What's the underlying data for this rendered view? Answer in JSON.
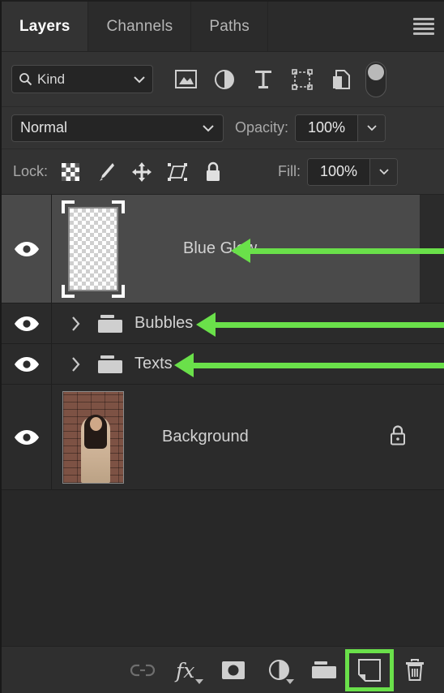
{
  "panel": {
    "tabs": [
      {
        "label": "Layers",
        "active": true
      },
      {
        "label": "Channels",
        "active": false
      },
      {
        "label": "Paths",
        "active": false
      }
    ],
    "menu_icon": "hamburger-menu-icon"
  },
  "filter": {
    "kind_label": "Kind",
    "search_icon": "search-icon",
    "dropdown_icon": "chevron-down-icon",
    "icons": [
      "pixel-layer-filter-icon",
      "adjustment-layer-filter-icon",
      "type-layer-filter-icon",
      "shape-layer-filter-icon",
      "smart-object-filter-icon",
      "filter-toggle-switch"
    ]
  },
  "blend": {
    "mode": "Normal",
    "opacity_label": "Opacity:",
    "opacity_value": "100%",
    "dropdown_icon": "chevron-down-icon"
  },
  "lock": {
    "label": "Lock:",
    "icons": [
      "lock-transparent-pixels-icon",
      "lock-image-pixels-icon",
      "lock-position-icon",
      "lock-artboard-nesting-icon",
      "lock-all-icon"
    ],
    "fill_label": "Fill:",
    "fill_value": "100%"
  },
  "layers": [
    {
      "name": "Blue Glow",
      "visible": true,
      "selected": true,
      "thumb": "transparent-checker",
      "type": "layer",
      "locked": false,
      "annotated": true
    },
    {
      "name": "Bubbles",
      "visible": true,
      "selected": false,
      "thumb": "folder",
      "type": "group",
      "locked": false,
      "annotated": true
    },
    {
      "name": "Texts",
      "visible": true,
      "selected": false,
      "thumb": "folder",
      "type": "group",
      "locked": false,
      "annotated": true
    },
    {
      "name": "Background",
      "visible": true,
      "selected": false,
      "thumb": "photo",
      "type": "layer",
      "locked": true,
      "annotated": false
    }
  ],
  "bottom_toolbar": {
    "icons": [
      {
        "name": "link-layers-icon",
        "enabled": false,
        "highlighted": false
      },
      {
        "name": "layer-style-fx-icon",
        "enabled": true,
        "highlighted": false
      },
      {
        "name": "add-layer-mask-icon",
        "enabled": true,
        "highlighted": false
      },
      {
        "name": "new-adjustment-layer-icon",
        "enabled": true,
        "highlighted": false
      },
      {
        "name": "new-group-icon",
        "enabled": true,
        "highlighted": false
      },
      {
        "name": "new-layer-icon",
        "enabled": true,
        "highlighted": true
      },
      {
        "name": "delete-layer-icon",
        "enabled": true,
        "highlighted": false
      }
    ]
  },
  "colors": {
    "panel_bg": "#282828",
    "row_bg": "#2b2b2b",
    "row_selected_bg": "#4a4a4a",
    "toolbar_bg": "#333333",
    "text": "#d2d2d2",
    "annotation_green": "#6ae04a"
  }
}
